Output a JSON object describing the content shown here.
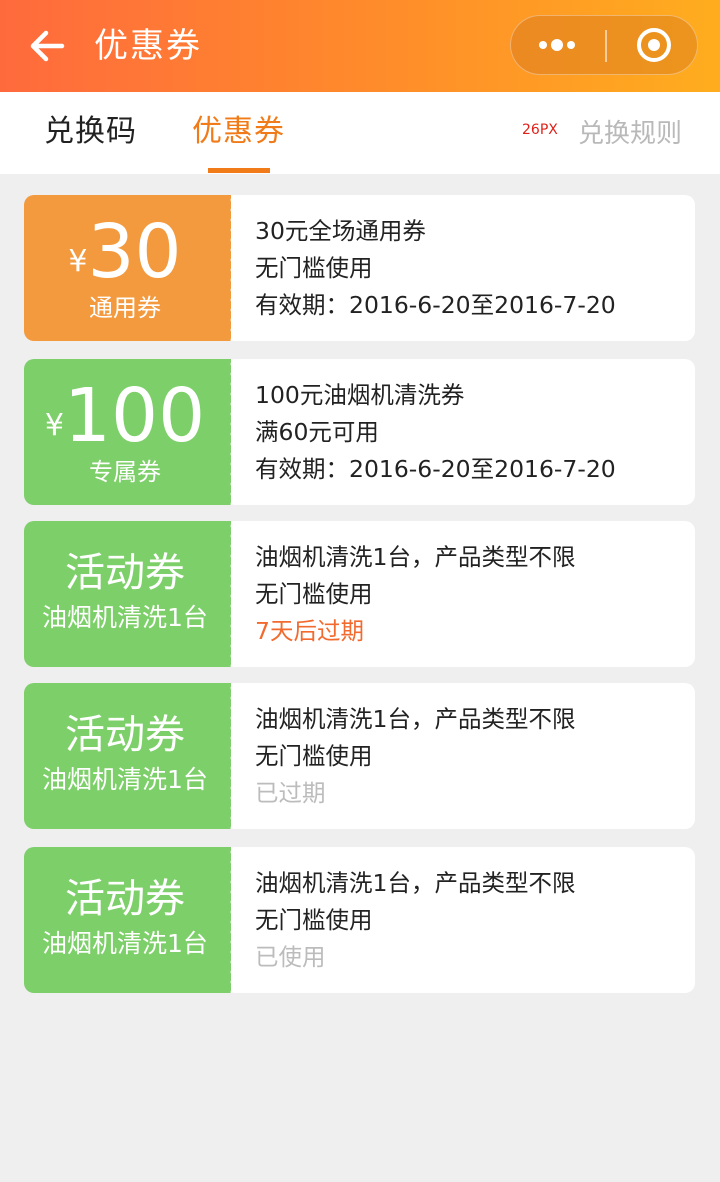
{
  "nav": {
    "title": "优惠券",
    "back_icon": "arrow-left-icon",
    "more_icon": "more-dots-icon",
    "close_icon": "target-circle-icon"
  },
  "tabs": {
    "redeem_code": "兑换码",
    "coupons": "优惠券",
    "px_note": "26PX",
    "rules": "兑换规则",
    "active_color": "#f07b18"
  },
  "coupons": [
    {
      "style": "orange",
      "currency": "¥",
      "amount": "30",
      "kind": "通用券",
      "name": "30元全场通用券",
      "condition": "无门槛使用",
      "validity": "有效期：2016-6-20至2016-7-20"
    },
    {
      "style": "green",
      "currency": "¥",
      "amount": "100",
      "kind": "专属券",
      "name": "100元油烟机清洗券",
      "condition": "满60元可用",
      "validity": "有效期：2016-6-20至2016-7-20"
    },
    {
      "style": "green",
      "title": "活动券",
      "subtitle": "油烟机清洗1台",
      "name": "油烟机清洗1台，产品类型不限",
      "condition": "无门槛使用",
      "status": "7天后过期"
    },
    {
      "style": "green",
      "title": "活动券",
      "subtitle": "油烟机清洗1台",
      "name": "油烟机清洗1台，产品类型不限",
      "condition": "无门槛使用",
      "status": "已过期"
    },
    {
      "style": "green",
      "title": "活动券",
      "subtitle": "油烟机清洗1台",
      "name": "油烟机清洗1台，产品类型不限",
      "condition": "无门槛使用",
      "status": "已使用"
    }
  ],
  "colors": {
    "orange": "#f39a3e",
    "green": "#7dcf6a",
    "warning": "#f26a2e",
    "muted": "#bcbcbc"
  }
}
